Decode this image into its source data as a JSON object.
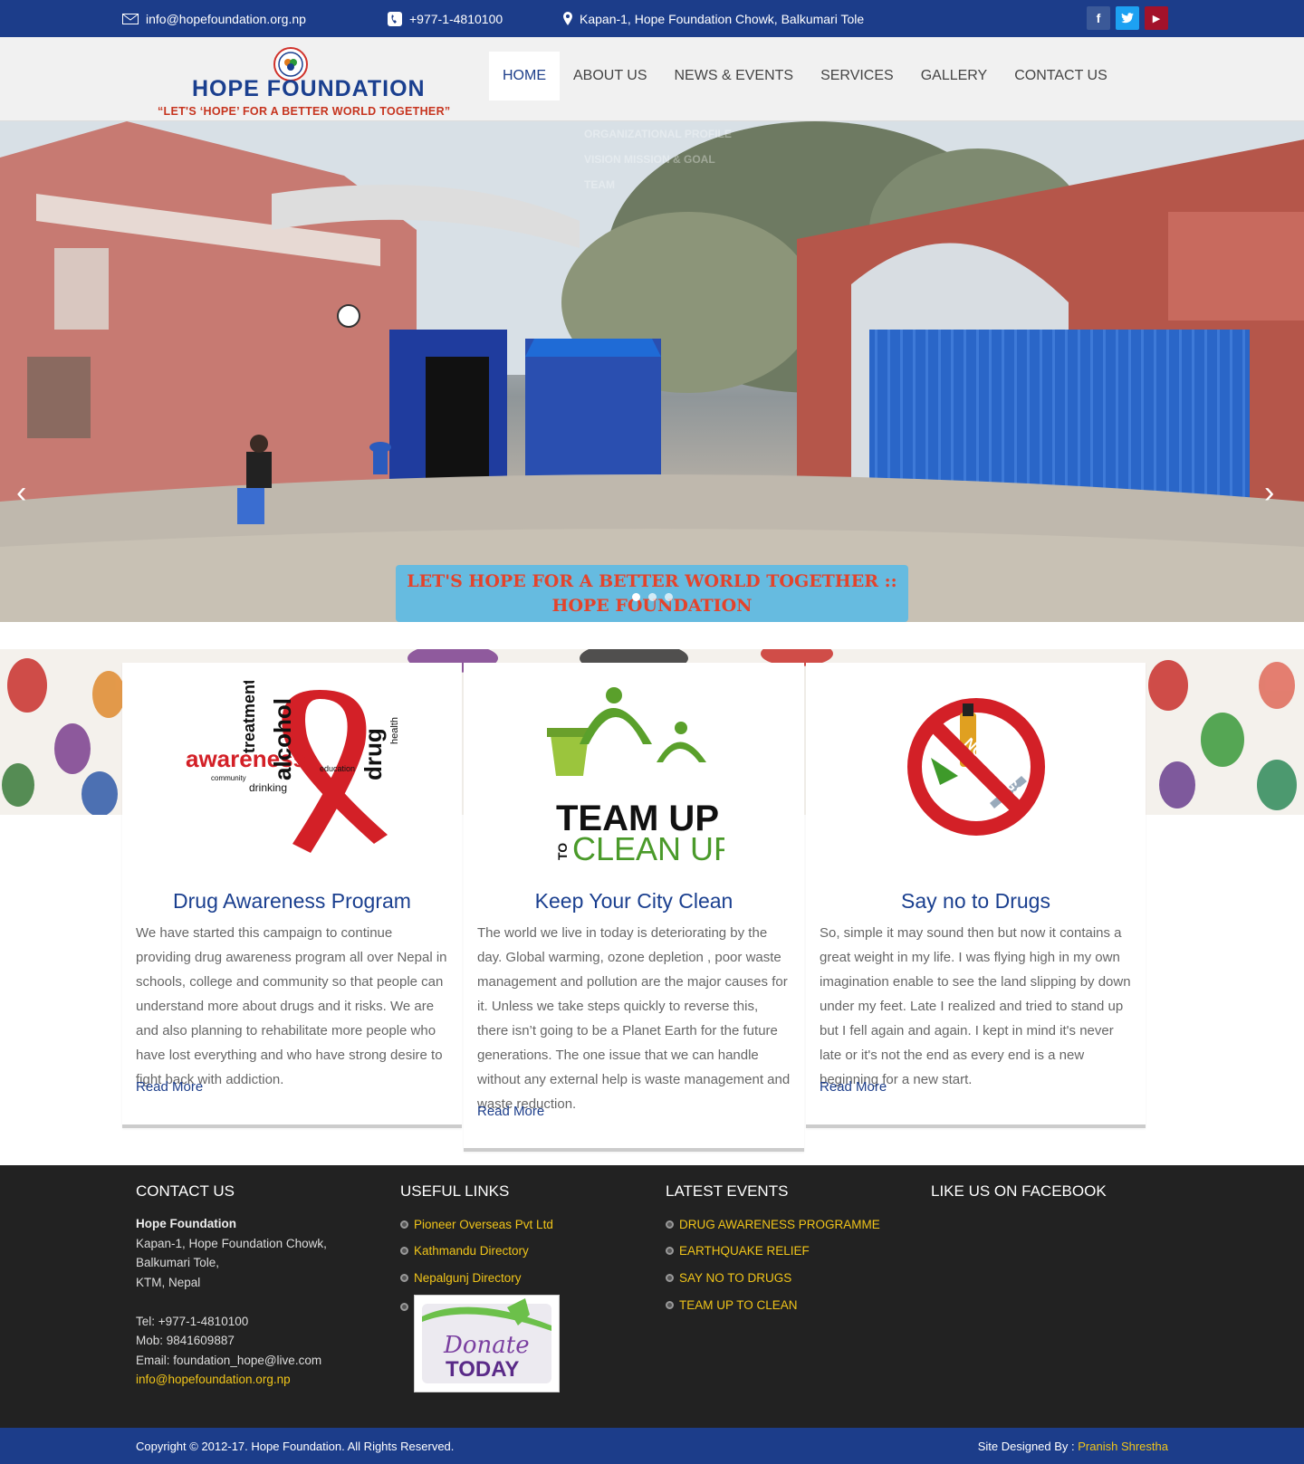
{
  "topbar": {
    "email": "info@hopefoundation.org.np",
    "phone": "+977-1-4810100",
    "address": "Kapan-1, Hope Foundation Chowk, Balkumari Tole",
    "social": [
      {
        "icon": "facebook-icon",
        "glyph": "f",
        "color": "#3b5998"
      },
      {
        "icon": "twitter-icon",
        "glyph": "t",
        "color": "#1da1f2"
      },
      {
        "icon": "youtube-icon",
        "glyph": "▶",
        "color": "#b31217"
      }
    ]
  },
  "logo": {
    "name": "HOPE FOUNDATION",
    "tagline": "“LET'S ‘HOPE’ FOR A BETTER WORLD TOGETHER”"
  },
  "nav": {
    "items": [
      "HOME",
      "ABOUT US",
      "NEWS & EVENTS",
      "SERVICES",
      "GALLERY",
      "CONTACT US"
    ],
    "active": "HOME"
  },
  "hero": {
    "caption_line1": "LET'S HOPE FOR A BETTER WORLD TOGETHER ::",
    "caption_line2": "HOPE FOUNDATION",
    "ghost_menu": [
      "ORGANIZATIONAL PROFILE",
      "VISION MISSION & GOAL",
      "TEAM"
    ]
  },
  "features": [
    {
      "title": "Drug Awareness Program",
      "text": "We have started this campaign to continue providing drug awareness program all over Nepal in schools, college and community so that people can understand more about drugs and it risks. We are and also planning to rehabilitate more people who have lost everything and who have strong desire to fight back with addiction.",
      "more": "Read More",
      "image_words": [
        "awareness",
        "alcohol",
        "treatment",
        "drug",
        "health",
        "community",
        "drinking",
        "education"
      ]
    },
    {
      "title": "Keep Your City Clean",
      "text": "The world we live in today is deteriorating by the day.  Global warming, ozone depletion , poor waste management and pollution are the major causes for it. Unless we take steps quickly to reverse this, there isn’t going to be a Planet Earth for the future generations. The one issue that we can handle without any external help is waste management and waste reduction.",
      "more": "Read More",
      "image_text_1": "TEAM UP",
      "image_text_2": "TO",
      "image_text_3": "CLEAN UP"
    },
    {
      "title": "Say no to Drugs",
      "text": "So, simple it may sound then but now it contains a great weight in my life. I was flying high in my own imagination enable to see the land slipping by down under my feet. Late I realized and tried to stand up but I fell again and again. I kept in mind it's never late or it's not the end as every end is a new beginning for a new start.",
      "more": "Read More",
      "image_text": "NO DRUGS"
    }
  ],
  "footer": {
    "contact": {
      "heading": "CONTACT US",
      "org": "Hope Foundation",
      "addr1": "Kapan-1, Hope Foundation Chowk,",
      "addr2": "Balkumari Tole,",
      "addr3": "KTM, Nepal",
      "tel": "Tel: +977-1-4810100",
      "mob": "Mob: 9841609887",
      "email": "Email: foundation_hope@live.com",
      "email2": "info@hopefoundation.org.np"
    },
    "links": {
      "heading": "USEFUL LINKS",
      "items": [
        "Pioneer Overseas Pvt Ltd",
        "Kathmandu Directory",
        "Nepalgunj Directory"
      ],
      "donate_1": "Donate",
      "donate_2": "TODAY"
    },
    "events": {
      "heading": "LATEST EVENTS",
      "items": [
        "DRUG AWARENESS PROGRAMME",
        "EARTHQUAKE RELIEF",
        "SAY NO TO DRUGS",
        "TEAM UP TO CLEAN"
      ]
    },
    "facebook": {
      "heading": "LIKE US ON FACEBOOK"
    }
  },
  "bottom": {
    "copyright": "Copyright © 2012-17. Hope Foundation. All Rights Reserved.",
    "designed_label": "Site Designed By : ",
    "designer": "Pranish Shrestha"
  },
  "colors": {
    "primary": "#1c3d8a",
    "accent": "#f0c419",
    "caption": "#e4432b"
  }
}
